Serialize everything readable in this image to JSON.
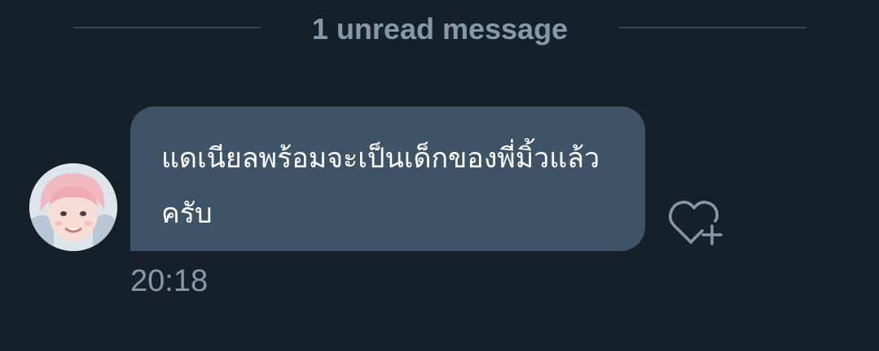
{
  "divider": {
    "label": "1 unread message"
  },
  "message": {
    "text": "แดเนียลพร้อมจะเป็นเด็กของพี่มิ้วแล้วครับ",
    "time": "20:18",
    "avatar_icon": "profile-avatar",
    "reaction_icon": "heart-add-icon"
  },
  "colors": {
    "background": "#16202b",
    "bubble": "#3e5366",
    "muted_text": "#8899a6",
    "divider_line": "#38444d",
    "message_text": "#ffffff"
  }
}
